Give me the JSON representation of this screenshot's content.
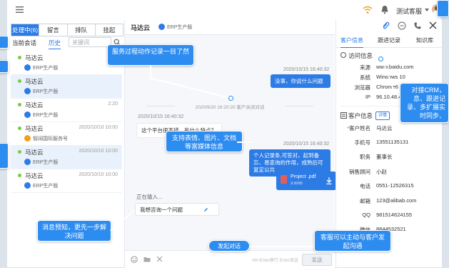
{
  "topbar": {
    "agent_name": "测试客服"
  },
  "left_panel": {
    "tabs": [
      "处理中(6)",
      "留言",
      "排队",
      "挂起"
    ],
    "subtabs": [
      "当前会话",
      "历史"
    ],
    "search_placeholder": "关键词",
    "sessions": [
      {
        "name": "马达云",
        "time": "",
        "company": "ERP生产版"
      },
      {
        "name": "马达云",
        "time": "",
        "company": "ERP生产版"
      },
      {
        "name": "马达云",
        "time": "2:20",
        "company": "ERP生产版"
      },
      {
        "name": "马达云",
        "time": "2020/10/10 10:00",
        "company": "智阔国际服务号"
      },
      {
        "name": "马达云",
        "time": "2020/10/10 10:00",
        "company": "ERP生产版"
      },
      {
        "name": "马达云",
        "time": "2020/10/10 10:00",
        "company": "ERP生产版"
      }
    ]
  },
  "chat": {
    "customer_name": "马达云",
    "customer_badge": "ERP生产版",
    "msg1_time": "2020/10/15  16:40:32",
    "msg1_text": "没事，你说什么问题",
    "system_text": "2020/9/20 16:20:20  客户关闭对话",
    "msg2_time": "2020/10/15  16:40:32",
    "msg2_text": "这个平台很不错，有什么特点？",
    "msg3_time": "2020/10/15  16:40:32",
    "msg3_text": "个人记录条,可答对，起到备忘、易查询的作用，成熟后可复定公共",
    "file_name": "Project .pdf",
    "file_size": "3.6mb",
    "typing": "正在输入...",
    "draft": "我想咨询一个问题",
    "input_hint": "Alt+Enter换行 Enter发送",
    "send_label": "发送"
  },
  "right_panel": {
    "tabs": [
      "客户信息",
      "跟进记录",
      "知识库"
    ],
    "visit_title": "访问信息",
    "visit": [
      {
        "k": "来源",
        "v": "www.baidu.com"
      },
      {
        "k": "系统",
        "v": "Windows 10"
      },
      {
        "k": "浏览器",
        "v": "Chrome6"
      },
      {
        "k": "IP",
        "v": "96.10.48.4"
      }
    ],
    "customer_title": "客户信息",
    "edit_label": "详情",
    "customer": [
      {
        "k": "客户姓名",
        "v": "马达云",
        "req": "*"
      },
      {
        "k": "手机号",
        "v": "13551135131",
        "req": ""
      },
      {
        "k": "职务",
        "v": "董事长",
        "req": ""
      },
      {
        "k": "销售顾问",
        "v": "小赵",
        "req": ""
      },
      {
        "k": "电话",
        "v": "0551-12526315",
        "req": ""
      },
      {
        "k": "邮箱",
        "v": "123@alibab.com",
        "req": ""
      },
      {
        "k": "QQ",
        "v": "981514624155",
        "req": ""
      },
      {
        "k": "微信",
        "v": "8844532521",
        "req": ""
      }
    ]
  },
  "callouts": {
    "process": "服务过程动作记录一目了然",
    "media": "支持表情、图片、文档等富媒体信息",
    "preview": "消息预知，更先一步解决问题",
    "initiate": "客服可以主动与客户发起沟通",
    "start_chat": "发起对话",
    "crm": "对接CRM，息、跟进记录、多扩展实时同步、"
  },
  "accent_color": "#2d7be5"
}
